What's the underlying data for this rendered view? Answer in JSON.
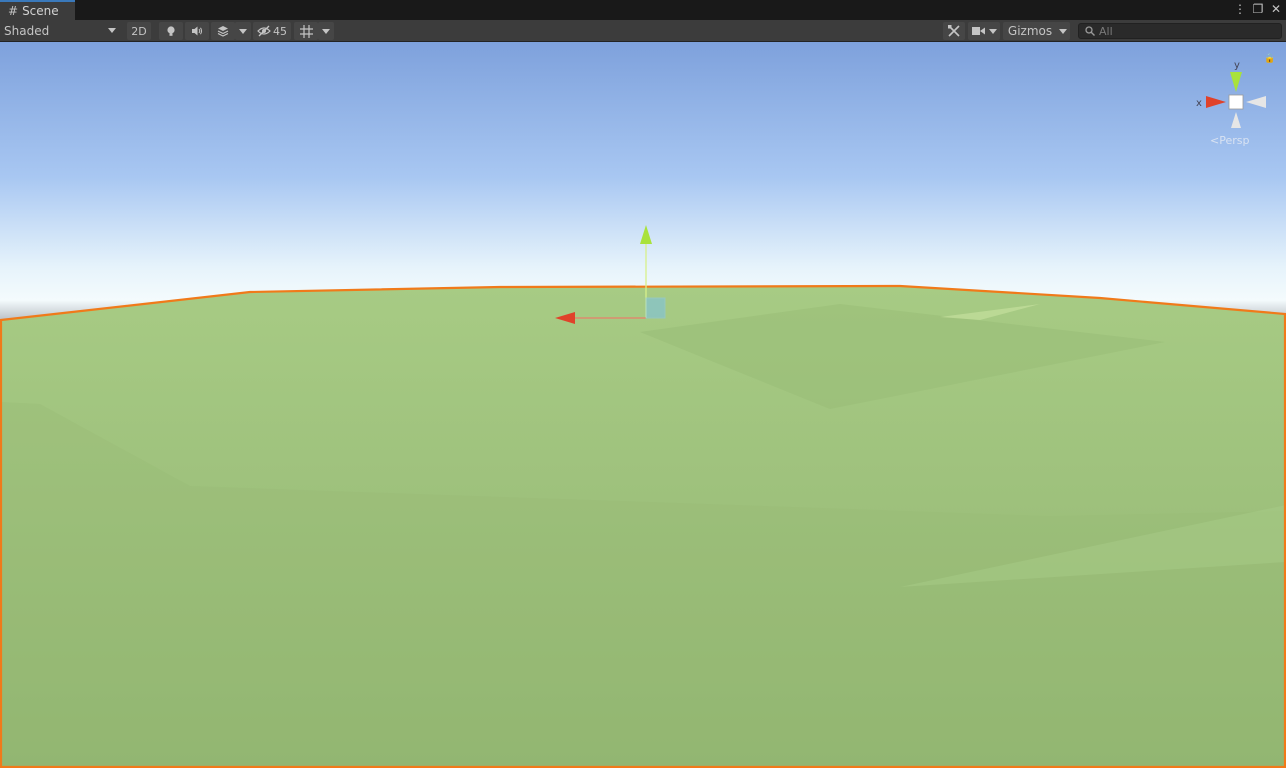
{
  "tab": {
    "title": "Scene"
  },
  "toolbar": {
    "shading_mode": "Shaded",
    "toggle_2d": "2D",
    "hidden_count": "45",
    "gizmos_label": "Gizmos",
    "search_placeholder": "All"
  },
  "scene_gizmo": {
    "axis_y": "y",
    "axis_x": "x",
    "projection": "Persp"
  },
  "colors": {
    "tab_accent": "#3a79bb",
    "selection_outline": "#f07a1a",
    "axis_x": "#e0422a",
    "axis_y": "#a9e23b",
    "ground": "#9ec27c",
    "sky_top": "#7ea1dc"
  }
}
